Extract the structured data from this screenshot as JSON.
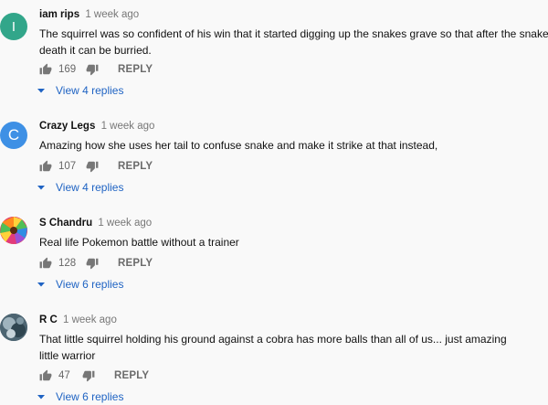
{
  "comments": [
    {
      "avatar_letter": "I",
      "avatar_color": "#32a68a",
      "author": "iam rips",
      "time": "1 week ago",
      "text": "The squirrel was so confident of his win that it started digging up the snakes grave  so that after the snakes death it can be burried.",
      "likes": "169",
      "reply_label": "REPLY",
      "replies_label": "View 4 replies"
    },
    {
      "avatar_letter": "C",
      "avatar_color": "#3e90e5",
      "author": "Crazy Legs",
      "time": "1 week ago",
      "text": "Amazing how she uses her tail to confuse snake and make it strike at that instead,",
      "likes": "107",
      "reply_label": "REPLY",
      "replies_label": "View 4 replies"
    },
    {
      "avatar_letter": "",
      "avatar_color": "#f5c518",
      "author": "S Chandru",
      "time": "1 week ago",
      "text": "Real life Pokemon battle without a trainer",
      "likes": "128",
      "reply_label": "REPLY",
      "replies_label": "View 6 replies"
    },
    {
      "avatar_letter": "",
      "avatar_color": "#5a7080",
      "author": "R C",
      "time": "1 week ago",
      "text": "That little squirrel holding his ground against a cobra has more balls than all of us... just amazing little warrior",
      "likes": "47",
      "reply_label": "REPLY",
      "replies_label": "View 6 replies"
    }
  ],
  "colors": {
    "background": "#f9f9f9",
    "link_blue": "#1f63c3",
    "meta_gray": "#777777"
  }
}
